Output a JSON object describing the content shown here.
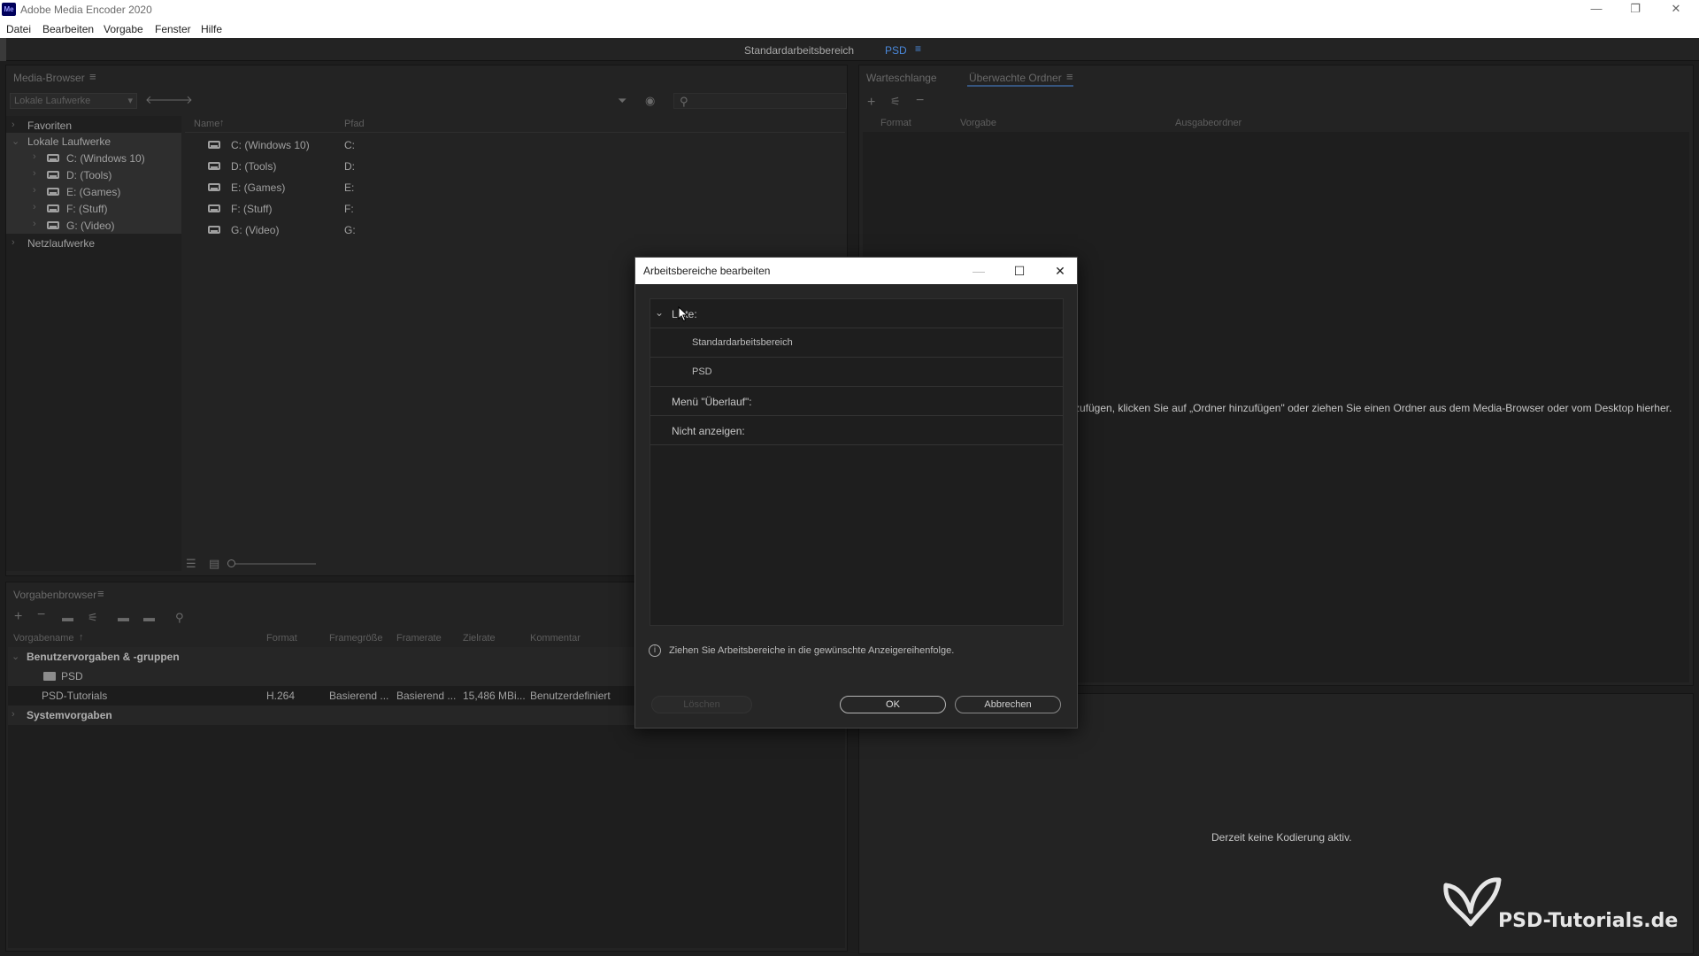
{
  "window": {
    "app_icon": "Me",
    "title": "Adobe Media Encoder 2020",
    "min": "—",
    "restore": "❐",
    "close": "✕"
  },
  "menu": [
    "Datei",
    "Bearbeiten",
    "Vorgabe",
    "Fenster",
    "Hilfe"
  ],
  "workspaces": {
    "standard": "Standardarbeitsbereich",
    "psd": "PSD",
    "menu_icon": "≡"
  },
  "media_browser": {
    "title": "Media-Browser",
    "location": "Lokale Laufwerke",
    "tree": {
      "favorites": "Favoriten",
      "local_drives": "Lokale Laufwerke",
      "drives": [
        "C: (Windows 10)",
        "D: (Tools)",
        "E: (Games)",
        "F: (Stuff)",
        "G: (Video)"
      ],
      "network_drives": "Netzlaufwerke"
    },
    "columns": {
      "name": "Name",
      "path": "Pfad"
    },
    "files": [
      {
        "name": "C: (Windows 10)",
        "path": "C:"
      },
      {
        "name": "D: (Tools)",
        "path": "D:"
      },
      {
        "name": "E: (Games)",
        "path": "E:"
      },
      {
        "name": "F: (Stuff)",
        "path": "F:"
      },
      {
        "name": "G: (Video)",
        "path": "G:"
      }
    ]
  },
  "queue": {
    "tab_queue": "Warteschlange",
    "tab_watched": "Überwachte Ordner",
    "columns": {
      "format": "Format",
      "preset": "Vorgabe",
      "output": "Ausgabeordner"
    },
    "hint": "zufügen, klicken Sie auf „Ordner hinzufügen\" oder ziehen Sie einen Ordner aus dem Media-Browser oder vom Desktop hierher."
  },
  "encoding": {
    "status": "Derzeit keine Kodierung aktiv."
  },
  "preset_browser": {
    "title": "Vorgabenbrowser",
    "columns": {
      "name": "Vorgabename",
      "format": "Format",
      "frame_size": "Framegröße",
      "frame_rate": "Framerate",
      "target_rate": "Zielrate",
      "comment": "Kommentar"
    },
    "user_group": "Benutzervorgaben & -gruppen",
    "folder": "PSD",
    "preset": {
      "name": "PSD-Tutorials",
      "format": "H.264",
      "frame_size": "Basierend ...",
      "frame_rate": "Basierend ...",
      "target_rate": "15,486 MBi...",
      "comment": "Benutzerdefiniert"
    },
    "system": "Systemvorgaben"
  },
  "dialog": {
    "title": "Arbeitsbereiche bearbeiten",
    "list_label": "Liste:",
    "items": [
      "Standardarbeitsbereich",
      "PSD"
    ],
    "overflow_label": "Menü \"Überlauf\":",
    "hide_label": "Nicht anzeigen:",
    "info": "Ziehen Sie Arbeitsbereiche in die gewünschte Anzeigereihenfolge.",
    "delete": "Löschen",
    "ok": "OK",
    "cancel": "Abbrechen"
  },
  "watermark": {
    "text": "PSD-Tutorials.de"
  }
}
